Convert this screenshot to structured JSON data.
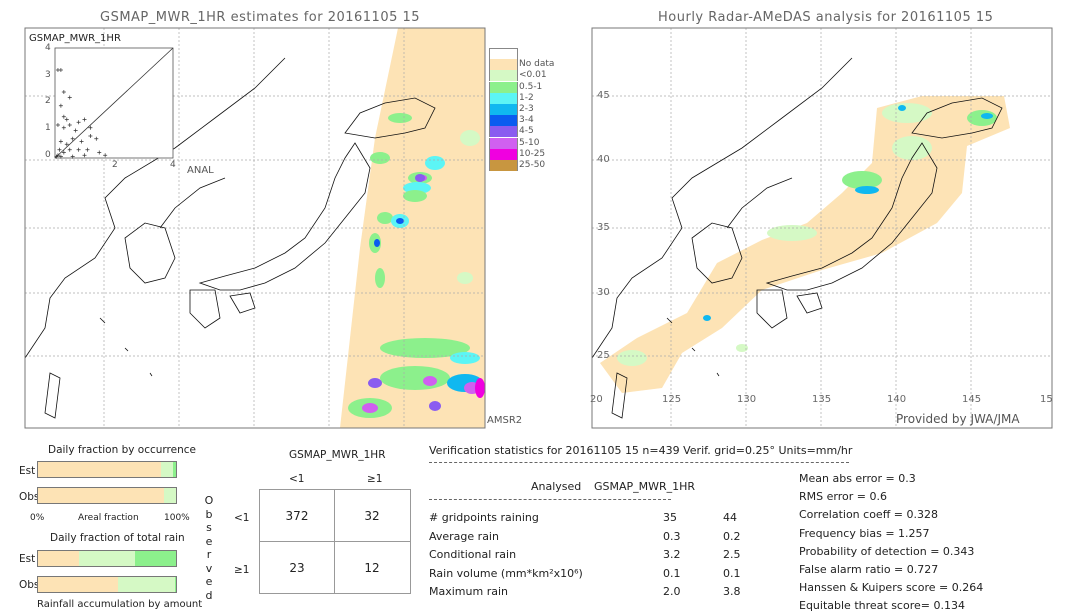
{
  "left_map": {
    "title": "GSMAP_MWR_1HR estimates for 20161105 15",
    "inset_title": "GSMAP_MWR_1HR",
    "inset_xlabel": "ANAL",
    "inset_ticks": [
      "0",
      "1",
      "2",
      "3",
      "4"
    ],
    "satellite": "AMSR2"
  },
  "right_map": {
    "title": "Hourly Radar-AMeDAS analysis for 20161105 15",
    "lat_labels": [
      "45",
      "40",
      "35",
      "30",
      "25",
      "20"
    ],
    "lon_labels": [
      "125",
      "130",
      "135",
      "140",
      "145",
      "15"
    ],
    "lon_first": "20",
    "credit": "Provided by JWA/JMA"
  },
  "legend": [
    {
      "label": "",
      "color": "#ffffff"
    },
    {
      "label": "No data",
      "color": "#fde3b5"
    },
    {
      "label": "<0.01",
      "color": "#d5f9c5"
    },
    {
      "label": "0.5-1",
      "color": "#8cf08c"
    },
    {
      "label": "1-2",
      "color": "#5cf5f5"
    },
    {
      "label": "2-3",
      "color": "#10b8f0"
    },
    {
      "label": "3-4",
      "color": "#0a5cf0"
    },
    {
      "label": "4-5",
      "color": "#8a5cf0"
    },
    {
      "label": "5-10",
      "color": "#d060f0"
    },
    {
      "label": "10-25",
      "color": "#f000e0"
    },
    {
      "label": "25-50",
      "color": "#c89640"
    }
  ],
  "fractions": {
    "occ_title": "Daily fraction by occurrence",
    "est": "Est",
    "obs": "Obs",
    "axis_left": "0%",
    "axis_mid": "Areal fraction",
    "axis_right": "100%",
    "rain_title": "Daily fraction of total rain",
    "rain_caption": "Rainfall accumulation by amount"
  },
  "contingency": {
    "model": "GSMAP_MWR_1HR",
    "col_lt": "<1",
    "col_ge": "≥1",
    "observed": "Observed",
    "row_lt": "<1",
    "row_ge": "≥1",
    "values": [
      "372",
      "32",
      "23",
      "12"
    ]
  },
  "stats": {
    "header": "Verification statistics for 20161105 15  n=439  Verif. grid=0.25°  Units=mm/hr",
    "col1": "Analysed",
    "col2": "GSMAP_MWR_1HR",
    "rows": [
      {
        "label": "# gridpoints raining",
        "a": "35",
        "b": "44"
      },
      {
        "label": "Average rain",
        "a": "0.3",
        "b": "0.2"
      },
      {
        "label": "Conditional rain",
        "a": "3.2",
        "b": "2.5"
      },
      {
        "label": "Rain volume (mm*km²x10⁶)",
        "a": "0.1",
        "b": "0.1"
      },
      {
        "label": "Maximum rain",
        "a": "2.0",
        "b": "3.8"
      }
    ],
    "scores": [
      "Mean abs error = 0.3",
      "RMS error = 0.6",
      "Correlation coeff = 0.328",
      "Frequency bias = 1.257",
      "Probability of detection = 0.343",
      "False alarm ratio = 0.727",
      "Hanssen & Kuipers score = 0.264",
      "Equitable threat score= 0.134"
    ]
  },
  "chart_data": [
    {
      "type": "scatter",
      "title": "GSMAP_MWR_1HR",
      "xlabel": "ANAL",
      "ylabel": "GSMAP_MWR_1HR",
      "xlim": [
        0,
        4
      ],
      "ylim": [
        0,
        4
      ],
      "diagonal": true,
      "points": [
        [
          0.1,
          3.2
        ],
        [
          0.2,
          3.2
        ],
        [
          0.3,
          2.4
        ],
        [
          0.5,
          2.2
        ],
        [
          0.2,
          1.9
        ],
        [
          0.3,
          1.5
        ],
        [
          0.4,
          1.4
        ],
        [
          0.1,
          1.2
        ],
        [
          0.3,
          1.1
        ],
        [
          0.5,
          1.2
        ],
        [
          0.7,
          1.0
        ],
        [
          0.8,
          1.3
        ],
        [
          1.0,
          1.4
        ],
        [
          1.2,
          0.8
        ],
        [
          0.9,
          0.6
        ],
        [
          0.6,
          0.7
        ],
        [
          0.4,
          0.5
        ],
        [
          0.2,
          0.6
        ],
        [
          0.5,
          0.3
        ],
        [
          0.8,
          0.3
        ],
        [
          1.1,
          0.3
        ],
        [
          1.5,
          0.2
        ],
        [
          1.4,
          0.7
        ],
        [
          1.2,
          1.1
        ],
        [
          0.3,
          0.2
        ],
        [
          0.1,
          0.1
        ],
        [
          0.05,
          0.05
        ],
        [
          0.2,
          0.05
        ],
        [
          0.6,
          0.05
        ],
        [
          1.0,
          0.1
        ],
        [
          1.7,
          0.1
        ],
        [
          0.15,
          0.3
        ]
      ]
    },
    {
      "type": "bar",
      "title": "Daily fraction by occurrence",
      "stacked": true,
      "categories": [
        "Est",
        "Obs"
      ],
      "series": [
        {
          "color": "#fde3b5",
          "values": [
            89,
            91
          ]
        },
        {
          "color": "#d5f9c5",
          "values": [
            9,
            9
          ]
        },
        {
          "color": "#8cf08c",
          "values": [
            2,
            0
          ]
        }
      ]
    },
    {
      "type": "bar",
      "title": "Daily fraction of total rain",
      "stacked": true,
      "categories": [
        "Est",
        "Obs"
      ],
      "series": [
        {
          "color": "#fde3b5",
          "values": [
            30,
            58
          ]
        },
        {
          "color": "#d5f9c5",
          "values": [
            40,
            41
          ]
        },
        {
          "color": "#8cf08c",
          "values": [
            30,
            1
          ]
        }
      ]
    }
  ]
}
